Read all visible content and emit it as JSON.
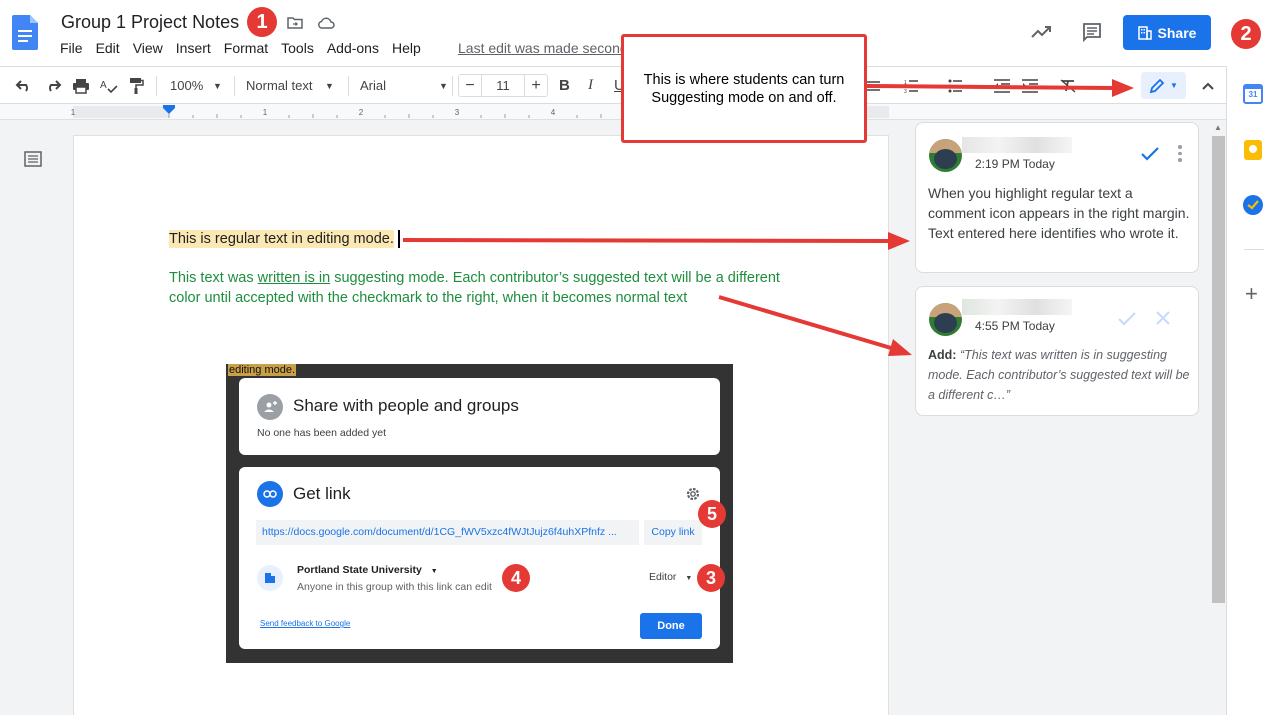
{
  "doc": {
    "title": "Group 1 Project Notes",
    "menu": [
      "File",
      "Edit",
      "View",
      "Insert",
      "Format",
      "Tools",
      "Add-ons",
      "Help"
    ],
    "last_edit": "Last edit was made seconds ago",
    "share_label": "Share"
  },
  "toolbar": {
    "zoom": "100%",
    "style": "Normal text",
    "font": "Arial",
    "font_size": "11",
    "minus": "−",
    "plus": "+",
    "bold": "B",
    "italic": "I",
    "underline": "U"
  },
  "callout": {
    "text": "This is where students can turn Suggesting mode on and off."
  },
  "body": {
    "regular_text": "This is regular text in editing mode.",
    "suggest_text_pre": "This text was ",
    "suggest_text_underlined": "written is in",
    "suggest_text_post": " suggesting mode. Each contributor’s suggested text will be a different color until accepted with the checkmark to the right, when it becomes normal text"
  },
  "comments": [
    {
      "time": "2:19 PM Today",
      "text": "When you highlight regular text a comment icon appears in the right margin. Text entered here identifies who wrote it."
    },
    {
      "time": "4:55 PM Today",
      "label": "Add:",
      "text": "“This text was written is in suggesting mode. Each contributor’s suggested text will be a different c…”"
    }
  ],
  "share_dialog": {
    "top_clip": "editing mode.",
    "share_title": "Share with people and groups",
    "share_sub": "No one has been added yet",
    "getlink_title": "Get link",
    "link_url": "https://docs.google.com/document/d/1CG_fWV5xzc4fWJtJujz6f4uhXPfnfz ...",
    "copy_link": "Copy link",
    "org": "Portland State University",
    "org_sub": "Anyone in this group with this link can edit",
    "role": "Editor",
    "feedback": "Send feedback to Google",
    "done": "Done"
  },
  "badges": [
    "1",
    "2",
    "3",
    "4",
    "5"
  ],
  "colors": {
    "accent": "#1a73e8",
    "suggest": "#1e8e3e",
    "highlight": "#fce8b2",
    "annotation": "#e53935"
  }
}
